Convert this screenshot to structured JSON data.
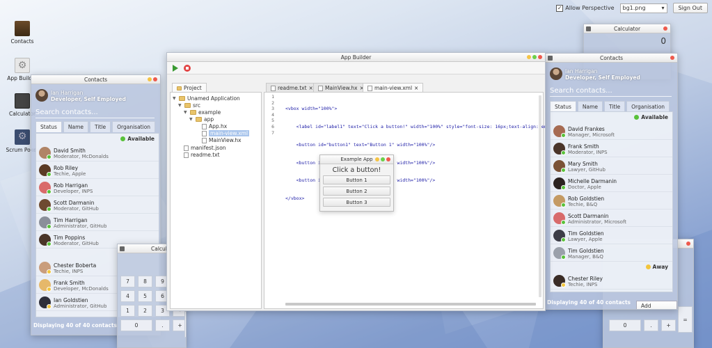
{
  "topbar": {
    "perspective_label": "Allow Perspective",
    "perspective_checked": "✓",
    "background_value": "bg1.png",
    "signout_label": "Sign Out"
  },
  "desktop_icons": [
    {
      "label": "Contacts"
    },
    {
      "label": "App Builder"
    },
    {
      "label": "Calculator"
    },
    {
      "label": "Scrum Poker"
    }
  ],
  "contacts_left": {
    "title": "Contacts",
    "user_name": "Ian Harrigan",
    "user_role": "Developer, Self Employed",
    "search_placeholder": "Search contacts...",
    "tabs": [
      "Status",
      "Name",
      "Title",
      "Organisation"
    ],
    "status_available": "Available",
    "contacts": [
      {
        "name": "David Smith",
        "role": "Moderator, McDonalds"
      },
      {
        "name": "Rob Riley",
        "role": "Techie, Apple"
      },
      {
        "name": "Rob Harrigan",
        "role": "Developer, INPS"
      },
      {
        "name": "Scott Darmanin",
        "role": "Moderator, GitHub"
      },
      {
        "name": "Tim Harrigan",
        "role": "Administrator, GitHub"
      },
      {
        "name": "Tim Poppins",
        "role": "Moderator, GitHub"
      },
      {
        "name": "Chester Boberta",
        "role": "Techie, INPS"
      },
      {
        "name": "Frank Smith",
        "role": "Developer, McDonalds"
      },
      {
        "name": "Ian Goldstien",
        "role": "Administrator, GitHub"
      }
    ],
    "footer": "Displaying 40 of 40 contacts"
  },
  "calc_left": {
    "title": "Calculator",
    "keys": [
      "7",
      "8",
      "9",
      "/",
      "4",
      "5",
      "6",
      "*",
      "1",
      "2",
      "3",
      "-",
      "0",
      ".",
      "+",
      "="
    ]
  },
  "calc_right_top": {
    "title": "Calculator",
    "display": "0"
  },
  "calc_right_bottom": {
    "keys": [
      "0",
      ".",
      "+",
      "="
    ]
  },
  "builder": {
    "title": "App Builder",
    "project_tab": "Project",
    "tree": {
      "root": "Unamed Application",
      "src": "src",
      "example": "example",
      "app": "app",
      "files": [
        "App.hx",
        "main-view.xml",
        "MainView.hx"
      ],
      "manifest": "manifest.json",
      "readme": "readme.txt"
    },
    "editor_tabs": [
      "readme.txt",
      "MainView.hx",
      "main-view.xml"
    ],
    "tab_close": "×",
    "line_numbers": [
      "1",
      "2",
      "3",
      "4",
      "5",
      "6",
      "7"
    ],
    "code_lines": [
      "<vbox width=\"100%\">",
      "    <label id=\"label1\" text=\"Click a button!\" width=\"100%\" style=\"font-size: 16px;text-align:center\" />",
      "    <button id=\"button1\" text=\"Button 1\" width=\"100%\"/>",
      "    <button id=\"button2\" text=\"Button 2\" width=\"100%\"/>",
      "    <button id=\"button3\" text=\"Button 3\" width=\"100%\"/>",
      "</vbox>",
      ""
    ]
  },
  "example_app": {
    "title": "Example App",
    "label": "Click a button!",
    "buttons": [
      "Button 1",
      "Button 2",
      "Button 3"
    ]
  },
  "contacts_right": {
    "title": "Contacts",
    "user_name": "Ian Harrigan",
    "user_role": "Developer, Self Employed",
    "search_placeholder": "Search contacts...",
    "tabs": [
      "Status",
      "Name",
      "Title",
      "Organisation"
    ],
    "status_available": "Available",
    "status_away": "Away",
    "contacts": [
      {
        "name": "David Frankes",
        "role": "Manager, Microsoft"
      },
      {
        "name": "Frank Smith",
        "role": "Moderator, INPS"
      },
      {
        "name": "Mary Smith",
        "role": "Lawyer, GitHub"
      },
      {
        "name": "Michelle Darmanin",
        "role": "Doctor, Apple"
      },
      {
        "name": "Rob Goldstien",
        "role": "Techie, B&Q"
      },
      {
        "name": "Scott Darmanin",
        "role": "Administrator, Microsoft"
      },
      {
        "name": "Tim Goldstien",
        "role": "Lawyer, Apple"
      },
      {
        "name": "Tim Goldstien",
        "role": "Manager, B&Q"
      }
    ],
    "away_contacts": [
      {
        "name": "Chester Riley",
        "role": "Techie, INPS"
      }
    ],
    "footer": "Displaying 40 of 40 contacts",
    "add_label": "Add Contact"
  }
}
